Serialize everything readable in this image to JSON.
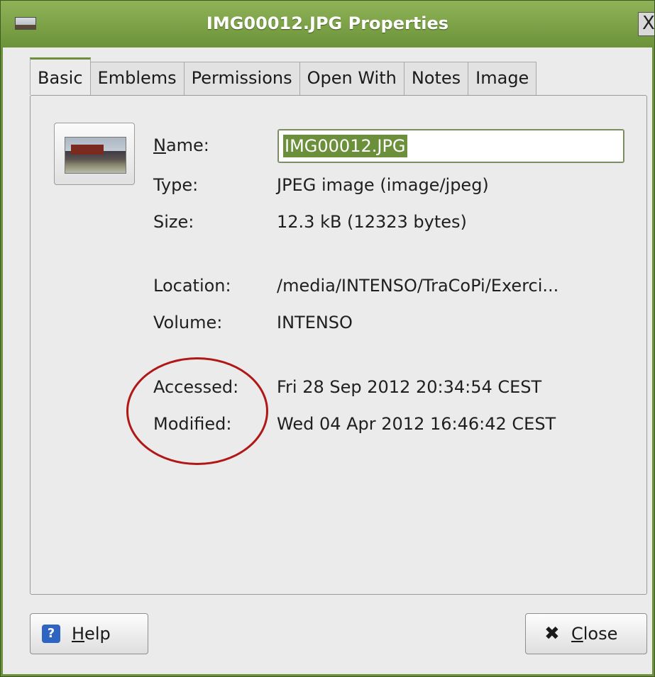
{
  "window": {
    "title": "IMG00012.JPG Properties",
    "close_glyph": "X",
    "app_icon": "image-file-icon"
  },
  "tabs": [
    {
      "label": "Basic",
      "active": true
    },
    {
      "label": "Emblems",
      "active": false
    },
    {
      "label": "Permissions",
      "active": false
    },
    {
      "label": "Open With",
      "active": false
    },
    {
      "label": "Notes",
      "active": false
    },
    {
      "label": "Image",
      "active": false
    }
  ],
  "basic": {
    "name_label_mnemonic": "N",
    "name_label_rest": "ame:",
    "name_value": "IMG00012.JPG",
    "type_label": "Type:",
    "type_value": "JPEG image (image/jpeg)",
    "size_label": "Size:",
    "size_value": "12.3 kB (12323 bytes)",
    "location_label": "Location:",
    "location_value": "/media/INTENSO/TraCoPi/Exerci...",
    "volume_label": "Volume:",
    "volume_value": "INTENSO",
    "accessed_label": "Accessed:",
    "accessed_value": "Fri 28 Sep 2012 20:34:54 CEST",
    "modified_label": "Modified:",
    "modified_value": "Wed 04 Apr 2012 16:46:42 CEST"
  },
  "buttons": {
    "help_icon": "?",
    "help_mnemonic": "H",
    "help_rest": "elp",
    "close_icon": "✖",
    "close_mnemonic": "C",
    "close_rest": "lose"
  },
  "colors": {
    "titlebar": "#6b8f3a",
    "selection": "#6b8f3a",
    "annotation": "#b01818"
  }
}
